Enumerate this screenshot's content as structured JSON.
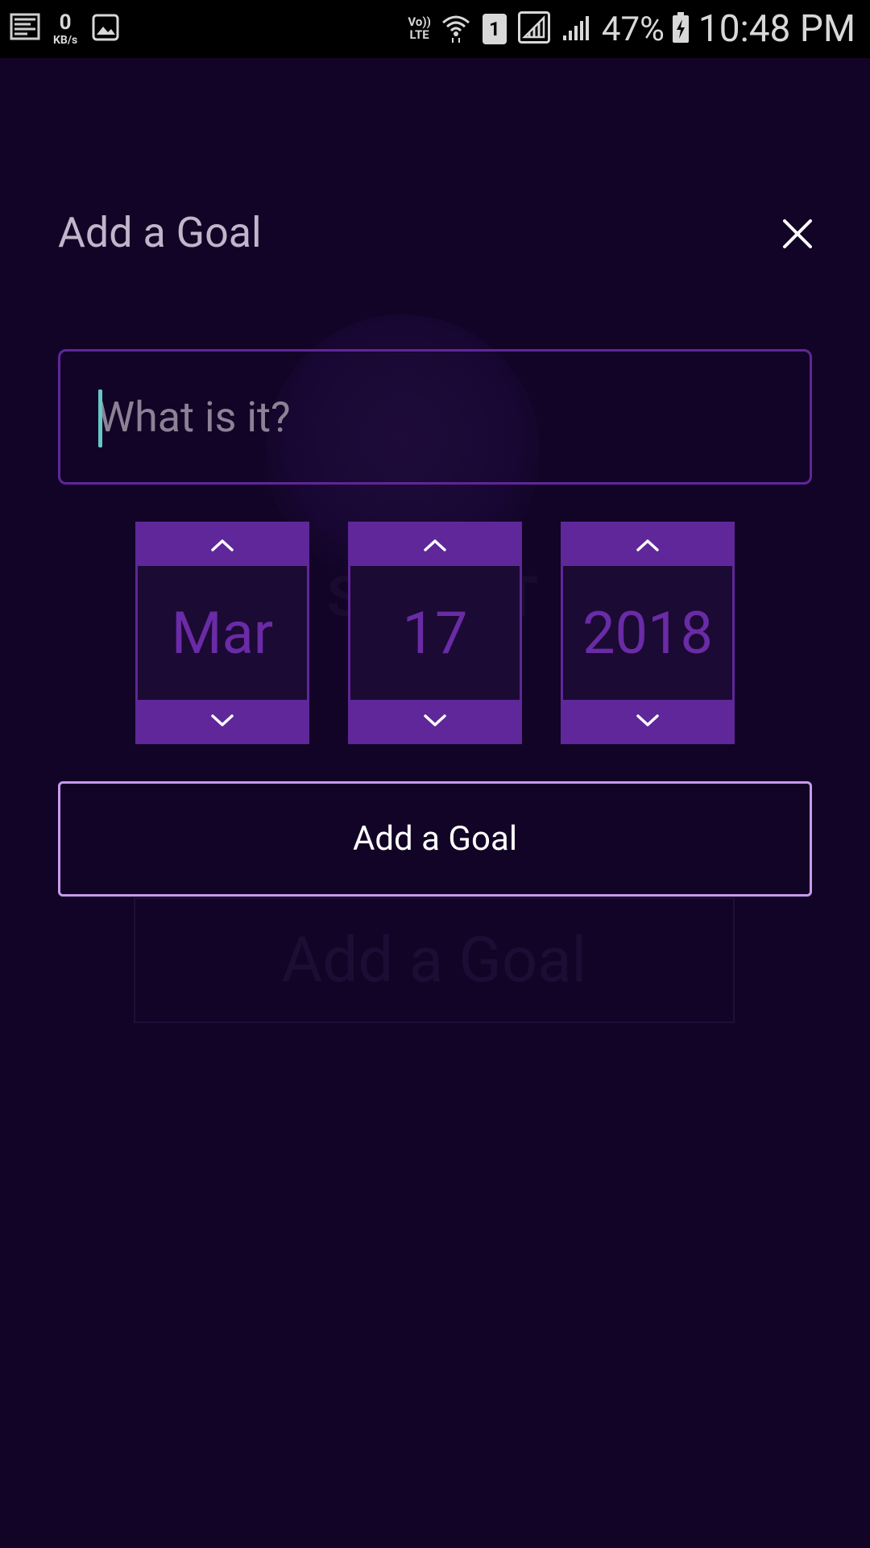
{
  "status_bar": {
    "data_speed_value": "0",
    "data_speed_unit": "KB/s",
    "volte_line1": "Vo))",
    "volte_line2": "LTE",
    "sim_slot": "1",
    "battery_percent": "47%",
    "time": "10:48 PM"
  },
  "dialog": {
    "title": "Add a Goal",
    "input_placeholder": "What is it?",
    "input_value": "",
    "date": {
      "month": "Mar",
      "day": "17",
      "year": "2018"
    },
    "submit_label": "Add a Goal"
  },
  "background": {
    "ghost_logo_text": "SMART",
    "ghost_button_label": "Add a Goal"
  },
  "colors": {
    "background": "#120426",
    "accent_purple": "#5f2799",
    "button_border": "#c79bec",
    "caret": "#67c8c4"
  }
}
